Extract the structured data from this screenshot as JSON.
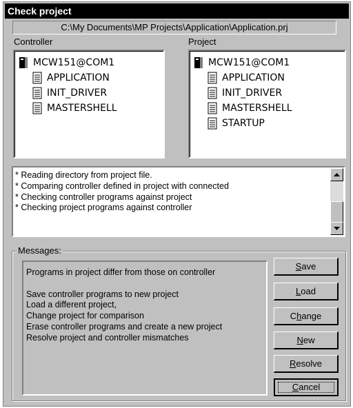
{
  "window": {
    "title": "Check project"
  },
  "project_path": "C:\\My Documents\\MP Projects\\Application\\Application.prj",
  "controller": {
    "label": "Controller",
    "root": "MCW151@COM1",
    "items": [
      "APPLICATION",
      "INIT_DRIVER",
      "MASTERSHELL"
    ]
  },
  "project": {
    "label": "Project",
    "root": "MCW151@COM1",
    "items": [
      "APPLICATION",
      "INIT_DRIVER",
      "MASTERSHELL",
      "STARTUP"
    ]
  },
  "log": {
    "lines": [
      "* Reading directory from project file.",
      "* Comparing controller defined in project with connected",
      "* Checking controller programs against project",
      "* Checking project programs against controller"
    ]
  },
  "messages": {
    "label": "Messages:",
    "lines": [
      "Programs in project differ from those on controller",
      "",
      "Save controller programs to new project",
      "Load a different project,",
      "Change project for comparison",
      "Erase controller programs and create a new project",
      "Resolve project and controller mismatches"
    ]
  },
  "buttons": {
    "save": {
      "pre": "",
      "key": "S",
      "post": "ave"
    },
    "load": {
      "pre": "",
      "key": "L",
      "post": "oad"
    },
    "change": {
      "pre": "C",
      "key": "h",
      "post": "ange"
    },
    "new": {
      "pre": "",
      "key": "N",
      "post": "ew"
    },
    "resolve": {
      "pre": "",
      "key": "R",
      "post": "esolve"
    },
    "cancel": {
      "pre": "",
      "key": "C",
      "post": "ancel"
    }
  },
  "icons": {
    "controller_root": "device-icon",
    "program": "document-icon"
  }
}
